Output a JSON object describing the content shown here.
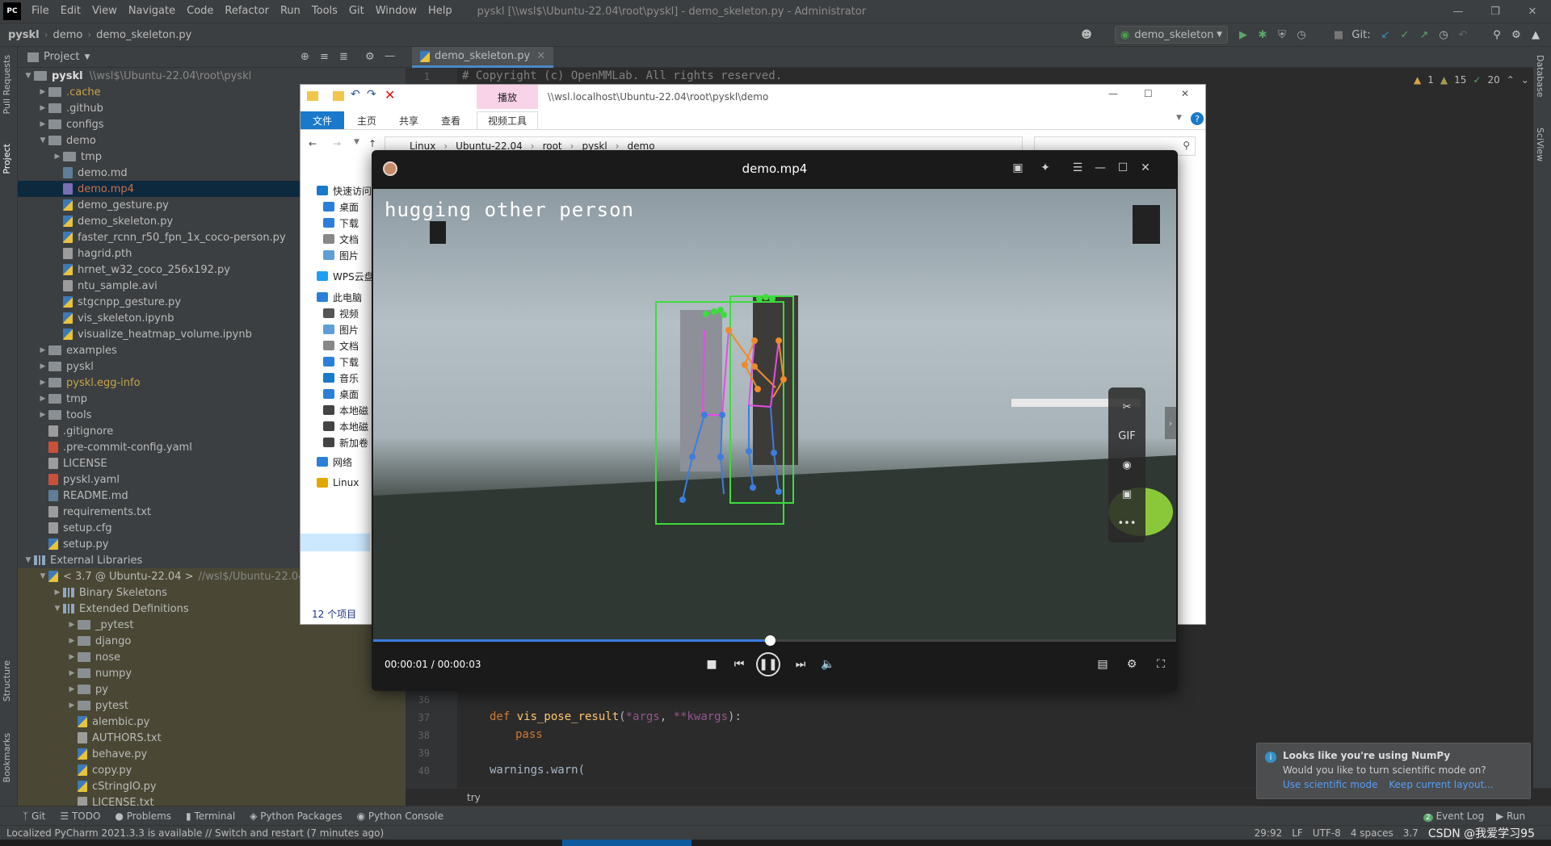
{
  "menubar": {
    "logo": "PC",
    "items": [
      "File",
      "Edit",
      "View",
      "Navigate",
      "Code",
      "Refactor",
      "Run",
      "Tools",
      "Git",
      "Window",
      "Help"
    ],
    "title": "pyskl [\\\\wsl$\\Ubuntu-22.04\\root\\pyskl] - demo_skeleton.py - Administrator"
  },
  "navbar": {
    "crumbs": [
      "pyskl",
      "demo",
      "demo_skeleton.py"
    ],
    "run_config": "demo_skeleton",
    "git_label": "Git:"
  },
  "left_strip": {
    "top_tabs": [
      "Pull Requests",
      "Project"
    ],
    "bottom_tabs": [
      "Structure",
      "Bookmarks"
    ]
  },
  "right_strip": {
    "tabs": [
      "Database",
      "SciView"
    ]
  },
  "project": {
    "header": "Project",
    "root": {
      "name": "pyskl",
      "path": "\\\\wsl$\\Ubuntu-22.04\\root\\pyskl"
    },
    "tree": [
      {
        "label": ".cache",
        "type": "folder",
        "color": "#c7a44a"
      },
      {
        "label": ".github",
        "type": "folder"
      },
      {
        "label": "configs",
        "type": "folder"
      },
      {
        "label": "demo",
        "type": "folder-open"
      },
      {
        "label": "tmp",
        "type": "folder"
      },
      {
        "label": "demo.md",
        "type": "md"
      },
      {
        "label": "demo.mp4",
        "type": "mp4",
        "color": "#cc6f4a"
      },
      {
        "label": "demo_gesture.py",
        "type": "py"
      },
      {
        "label": "demo_skeleton.py",
        "type": "py"
      },
      {
        "label": "faster_rcnn_r50_fpn_1x_coco-person.py",
        "type": "py"
      },
      {
        "label": "hagrid.pth",
        "type": "txt"
      },
      {
        "label": "hrnet_w32_coco_256x192.py",
        "type": "py"
      },
      {
        "label": "ntu_sample.avi",
        "type": "txt"
      },
      {
        "label": "stgcnpp_gesture.py",
        "type": "py"
      },
      {
        "label": "vis_skeleton.ipynb",
        "type": "py"
      },
      {
        "label": "visualize_heatmap_volume.ipynb",
        "type": "py"
      },
      {
        "label": "examples",
        "type": "folder"
      },
      {
        "label": "pyskl",
        "type": "folder"
      },
      {
        "label": "pyskl.egg-info",
        "type": "folder",
        "color": "#c7a44a"
      },
      {
        "label": "tmp",
        "type": "folder"
      },
      {
        "label": "tools",
        "type": "folder"
      },
      {
        "label": ".gitignore",
        "type": "txt"
      },
      {
        "label": ".pre-commit-config.yaml",
        "type": "yaml"
      },
      {
        "label": "LICENSE",
        "type": "txt"
      },
      {
        "label": "pyskl.yaml",
        "type": "yaml"
      },
      {
        "label": "README.md",
        "type": "md"
      },
      {
        "label": "requirements.txt",
        "type": "txt"
      },
      {
        "label": "setup.cfg",
        "type": "txt"
      },
      {
        "label": "setup.py",
        "type": "py"
      },
      {
        "label": "External Libraries",
        "type": "lib"
      },
      {
        "label": "< 3.7 @ Ubuntu-22.04 >",
        "type": "py",
        "suffix": "//wsl$/Ubuntu-22.04/roo"
      },
      {
        "label": "Binary Skeletons",
        "type": "lib"
      },
      {
        "label": "Extended Definitions",
        "type": "lib"
      },
      {
        "label": "_pytest",
        "type": "folder"
      },
      {
        "label": "django",
        "type": "folder"
      },
      {
        "label": "nose",
        "type": "folder"
      },
      {
        "label": "numpy",
        "type": "folder"
      },
      {
        "label": "py",
        "type": "folder"
      },
      {
        "label": "pytest",
        "type": "folder"
      },
      {
        "label": "alembic.py",
        "type": "py"
      },
      {
        "label": "AUTHORS.txt",
        "type": "txt"
      },
      {
        "label": "behave.py",
        "type": "py"
      },
      {
        "label": "copy.py",
        "type": "py"
      },
      {
        "label": "cStringIO.py",
        "type": "py"
      },
      {
        "label": "LICENSE.txt",
        "type": "txt"
      }
    ]
  },
  "editor": {
    "tab": "demo_skeleton.py",
    "inspection": {
      "warnings": "1",
      "weak": "15",
      "ok": "20"
    },
    "lines": [
      {
        "num": "1",
        "text": "# Copyright (c) OpenMMLab. All rights reserved."
      },
      {
        "num": "36",
        "text": ""
      },
      {
        "num": "37",
        "text": "def vis_pose_result(*args, **kwargs):"
      },
      {
        "num": "38",
        "text": "    pass"
      },
      {
        "num": "39",
        "text": ""
      },
      {
        "num": "40",
        "text": "warnings.warn("
      }
    ],
    "breadcrumb": "try"
  },
  "explorer": {
    "ribbon_context": "播放",
    "tabs": [
      "文件",
      "主页",
      "共享",
      "查看",
      "视频工具"
    ],
    "path_title": "\\\\wsl.localhost\\Ubuntu-22.04\\root\\pyskl\\demo",
    "address": [
      "Linux",
      "Ubuntu-22.04",
      "root",
      "pyskl",
      "demo"
    ],
    "nav": [
      "快速访问",
      "桌面",
      "下载",
      "文档",
      "图片",
      "WPS云盘",
      "此电脑",
      "视频",
      "图片",
      "文档",
      "下载",
      "音乐",
      "桌面",
      "本地磁",
      "本地磁",
      "新加卷",
      "网络",
      "Linux"
    ],
    "status": "12 个项目"
  },
  "player": {
    "title": "demo.mp4",
    "video_label": "hugging other person",
    "time": "00:00:01 / 00:00:03",
    "progress": 0.494,
    "side_tools": [
      "scissors-icon",
      "GIF",
      "record-icon",
      "screenshot-icon",
      "more-icon"
    ],
    "side_gif": "GIF"
  },
  "tool_tabs": [
    "Git",
    "TODO",
    "Problems",
    "Terminal",
    "Python Packages",
    "Python Console"
  ],
  "tool_tabs_right": [
    "Event Log",
    "Run"
  ],
  "event_log_count": "2",
  "status": {
    "message": "Localized PyCharm 2021.3.3 is available // Switch and restart (7 minutes ago)",
    "position": "29:92",
    "line_sep": "LF",
    "encoding": "UTF-8",
    "indent": "4 spaces",
    "interpreter": "3.7",
    "watermark": "CSDN @我爱学习95"
  },
  "notification": {
    "title": "Looks like you're using NumPy",
    "body": "Would you like to turn scientific mode on?",
    "action1": "Use scientific mode",
    "action2": "Keep current layout..."
  }
}
